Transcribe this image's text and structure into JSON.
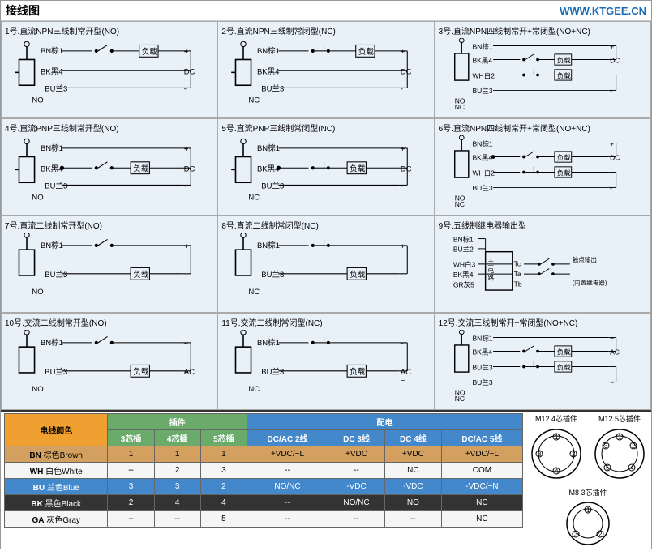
{
  "header": {
    "title": "接线图",
    "url": "WWW.KTGEE.CN"
  },
  "diagrams": [
    {
      "id": 1,
      "title": "1号.直流NPN三线制常开型(NO)",
      "type": "NPN3NO"
    },
    {
      "id": 2,
      "title": "2号.直流NPN三线制常闭型(NC)",
      "type": "NPN3NC"
    },
    {
      "id": 3,
      "title": "3号.直流NPN四线制常开+常闭型(NO+NC)",
      "type": "NPN4NONC"
    },
    {
      "id": 4,
      "title": "4号.直流PNP三线制常开型(NO)",
      "type": "PNP3NO"
    },
    {
      "id": 5,
      "title": "5号.直流PNP三线制常闭型(NC)",
      "type": "PNP3NC"
    },
    {
      "id": 6,
      "title": "6号.直流NPN四线制常开+常闭型(NO+NC)",
      "type": "PNP4NONC"
    },
    {
      "id": 7,
      "title": "7号.直流二线制常开型(NO)",
      "type": "2WIRE_NO_DC"
    },
    {
      "id": 8,
      "title": "8号.直流二线制常闭型(NC)",
      "type": "2WIRE_NC_DC"
    },
    {
      "id": 9,
      "title": "9号.五线制继电器输出型",
      "type": "5WIRE_RELAY"
    },
    {
      "id": 10,
      "title": "10号.交流二线制常开型(NO)",
      "type": "2WIRE_NO_AC"
    },
    {
      "id": 11,
      "title": "11号.交流二线制常闭型(NC)",
      "type": "2WIRE_NC_AC"
    },
    {
      "id": 12,
      "title": "12号.交流三线制常开+常闭型(NO+NC)",
      "type": "3WIRE_NONC_AC"
    }
  ],
  "table": {
    "wire_color_header": "电线颜色",
    "plugin_header": "插件",
    "power_header": "配电",
    "plugin_cols": [
      "3芯插",
      "4芯插",
      "5芯插"
    ],
    "power_cols": [
      "DC/AC 2线",
      "DC 3线",
      "DC 4线",
      "DC/AC 5线"
    ],
    "rows": [
      {
        "code": "BN",
        "cn_name": "棕色Brown",
        "plugins": [
          "1",
          "1",
          "1"
        ],
        "power": [
          "+VDC/~L",
          "+VDC",
          "+VDC",
          "+VDC/~L"
        ]
      },
      {
        "code": "WH",
        "cn_name": "白色White",
        "plugins": [
          "--",
          "2",
          "3"
        ],
        "power": [
          "--",
          "--",
          "NC",
          "COM"
        ]
      },
      {
        "code": "BU",
        "cn_name": "兰色Blue",
        "plugins": [
          "3",
          "3",
          "2"
        ],
        "power": [
          "NO/NC",
          "-VDC",
          "-VDC",
          "-VDC/~N"
        ]
      },
      {
        "code": "BK",
        "cn_name": "黑色Black",
        "plugins": [
          "2",
          "4",
          "4"
        ],
        "power": [
          "--",
          "NO/NC",
          "NO",
          "NC"
        ]
      },
      {
        "code": "GA",
        "cn_name": "灰色Gray",
        "plugins": [
          "--",
          "--",
          "5"
        ],
        "power": [
          "--",
          "--",
          "--",
          "NC"
        ]
      }
    ]
  },
  "connectors": {
    "m12_4pin_label": "M12 4芯插件",
    "m12_5pin_label": "M12 5芯插件",
    "m8_3pin_label": "M8 3芯插件"
  }
}
